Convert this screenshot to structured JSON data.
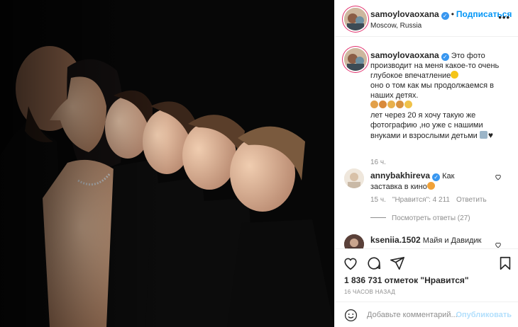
{
  "post": {
    "username": "samoylovaoxana",
    "verified": true,
    "follow_label": "Подписаться",
    "location": "Moscow, Russia",
    "more_icon": "more-icon",
    "image_alt_description": "family-profile-photo"
  },
  "caption": {
    "username": "samoylovaoxana",
    "text": "Это фото производит на меня какое-то очень глубокое впечатление",
    "line2": "оно о том как мы продолжаемся в наших детях.",
    "line3": "лет через 20 я хочу такую же фотографию ,но уже с нашими внуками и взрослыми детьми",
    "time": "16 ч."
  },
  "comments": [
    {
      "username": "annybakhireva",
      "verified": true,
      "text": "Как заставка в кино",
      "time": "15 ч.",
      "likes": "\"Нравится\": 4 211",
      "reply_label": "Ответить",
      "replies_label": "Посмотреть ответы (27)"
    },
    {
      "username": "kseniia.1502",
      "text": "Майя и Давидик"
    }
  ],
  "actions": {
    "like_icon": "heart-icon",
    "comment_icon": "comment-icon",
    "share_icon": "share-icon",
    "save_icon": "bookmark-icon"
  },
  "likes_text": "1 836 731 отметок \"Нравится\"",
  "time_ago": "16 ЧАСОВ НАЗАД",
  "add_comment": {
    "placeholder": "Добавьте комментарий...",
    "post_label": "Опубликовать"
  },
  "colors": {
    "accent": "#0095f6",
    "verified": "#3897f0",
    "muted": "#8e8e8e",
    "post_disabled": "#b2dffc"
  }
}
